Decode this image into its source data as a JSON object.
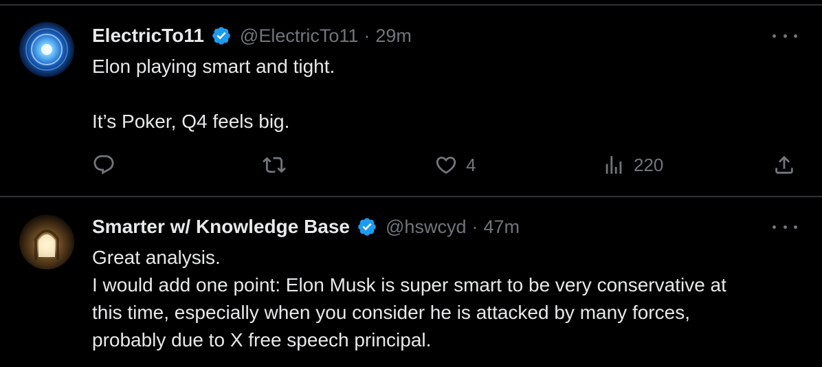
{
  "tweets": [
    {
      "display_name": "ElectricTo11",
      "handle": "@ElectricTo11",
      "separator": "·",
      "time": "29m",
      "lines": [
        "Elon playing smart and tight.",
        "",
        "It’s Poker, Q4 feels big."
      ],
      "actions": {
        "reply": {
          "icon": "reply-icon",
          "count": ""
        },
        "repost": {
          "icon": "repost-icon",
          "count": ""
        },
        "like": {
          "icon": "heart-icon",
          "count": "4"
        },
        "views": {
          "icon": "views-icon",
          "count": "220"
        },
        "share": {
          "icon": "share-icon",
          "count": ""
        }
      }
    },
    {
      "display_name": "Smarter w/ Knowledge Base",
      "handle": "@hswcyd",
      "separator": "·",
      "time": "47m",
      "lines": [
        "Great analysis.",
        "I would add one point: Elon Musk is super smart to be very conservative at",
        "this time, especially when you consider he is attacked by many forces,",
        "probably due to X free speech principal."
      ]
    }
  ],
  "colors": {
    "background": "#000000",
    "text": "#e7e9ea",
    "secondary": "#71767b",
    "verified": "#1d9bf0",
    "divider": "#2f3336"
  }
}
